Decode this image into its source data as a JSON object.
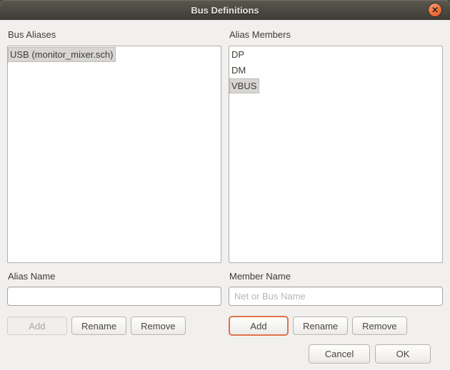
{
  "window": {
    "title": "Bus Definitions"
  },
  "icons": {
    "close": "✕"
  },
  "colors": {
    "titlebar_top": "#5b584f",
    "titlebar_bottom": "#3d3b36",
    "dialog_bg": "#f1f0ee",
    "close_button_orange": "#ec6f3c",
    "focus_orange": "#e0714a",
    "selection_gray": "#d8d6d2"
  },
  "bus_aliases": {
    "label": "Bus Aliases",
    "items": [
      "USB (monitor_mixer.sch)"
    ],
    "selected_index": 0,
    "name_label": "Alias Name",
    "input_value": "",
    "add_label": "Add",
    "rename_label": "Rename",
    "remove_label": "Remove",
    "add_enabled": false
  },
  "alias_members": {
    "label": "Alias Members",
    "items": [
      "DP",
      "DM",
      "VBUS"
    ],
    "selected_index": 2,
    "name_label": "Member Name",
    "input_placeholder": "Net or Bus Name",
    "add_label": "Add",
    "rename_label": "Rename",
    "remove_label": "Remove",
    "add_focused": true
  },
  "footer": {
    "cancel_label": "Cancel",
    "ok_label": "OK"
  }
}
